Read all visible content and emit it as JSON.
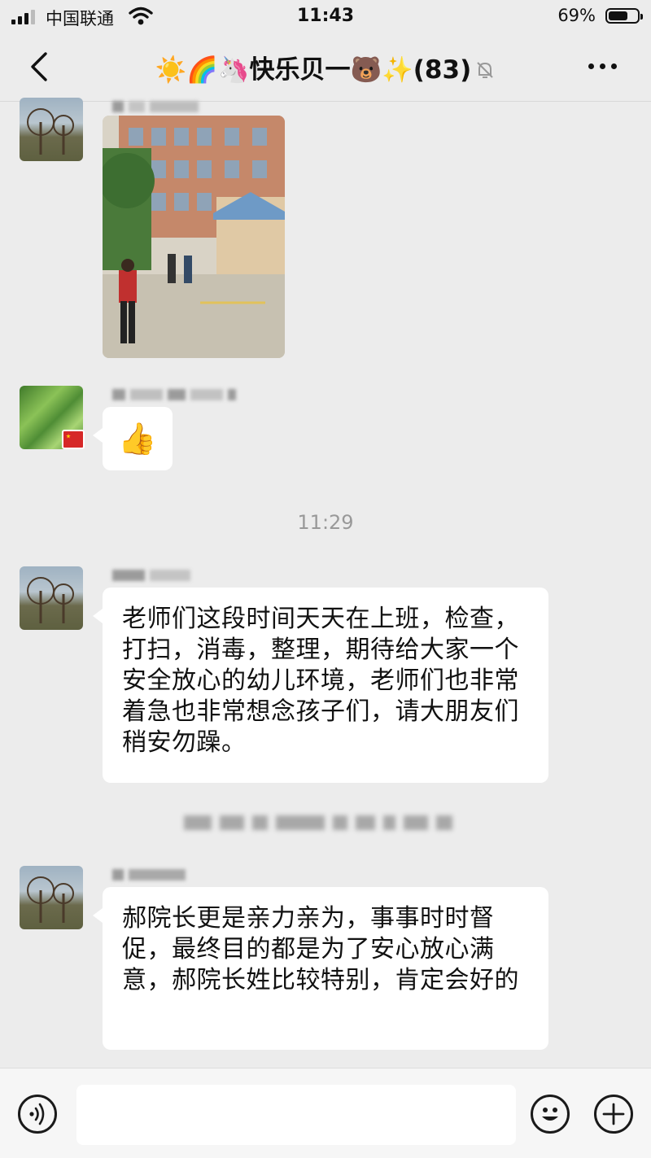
{
  "status_bar": {
    "carrier": "中国联通",
    "time": "11:43",
    "battery_percent": "69%",
    "battery_level": 0.69
  },
  "nav": {
    "title": "☀️🌈🦄快乐贝一🐻✨(83)",
    "back_icon": "chevron-left-icon",
    "mute_icon": "bell-off-icon",
    "more_icon": "more-dots-icon"
  },
  "messages": [
    {
      "type": "image",
      "description_icon": "photo-message"
    },
    {
      "type": "emoji",
      "content": "👍"
    },
    {
      "type": "time",
      "content": "11:29"
    },
    {
      "type": "text",
      "content": "老师们这段时间天天在上班，检查，打扫，消毒，整理，期待给大家一个安全放心的幼儿环境，老师们也非常着急也非常想念孩子们，请大朋友们稍安勿躁。"
    },
    {
      "type": "text",
      "content": "郝院长更是亲力亲为，事事时时督促，最终目的都是为了安心放心满意，郝院长姓比较特别，肯定会好的"
    }
  ],
  "input_bar": {
    "input_value": "",
    "voice_icon": "voice-icon",
    "emoji_icon": "smiley-icon",
    "add_icon": "plus-icon"
  }
}
